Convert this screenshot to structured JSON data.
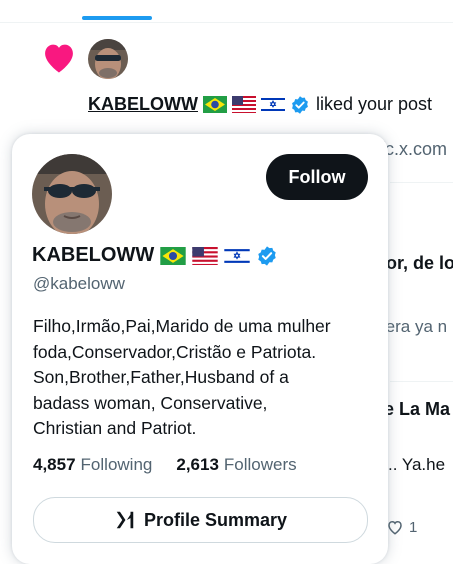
{
  "notification": {
    "username": "KABELOWW",
    "action_text": "liked your post",
    "flags": [
      "brazil-flag-icon",
      "usa-flag-icon",
      "israel-flag-icon"
    ],
    "heart_color": "#f91880"
  },
  "background": {
    "link_fragment": "fc.x.com",
    "post1_title_fragment": "mor, de lo",
    "post1_subtitle_fragment": "rera ya n",
    "post2_title_fragment": "e La Ma",
    "post2_text_fragment": ".. Ya.he",
    "like_count": "1"
  },
  "profile_card": {
    "display_name": "KABELOWW",
    "handle": "@kabeloww",
    "follow_label": "Follow",
    "bio_lines": [
      "Filho,Irmão,Pai,Marido de uma mulher",
      "foda,Conservador,Cristão e Patriota.",
      "Son,Brother,Father,Husband of a",
      "badass woman, Conservative,",
      "Christian and Patriot."
    ],
    "following_count": "4,857",
    "following_label": "Following",
    "followers_count": "2,613",
    "followers_label": "Followers",
    "summary_label": "Profile Summary",
    "verified_color": "#1d9bf0",
    "accent_color": "#1d9bf0"
  }
}
